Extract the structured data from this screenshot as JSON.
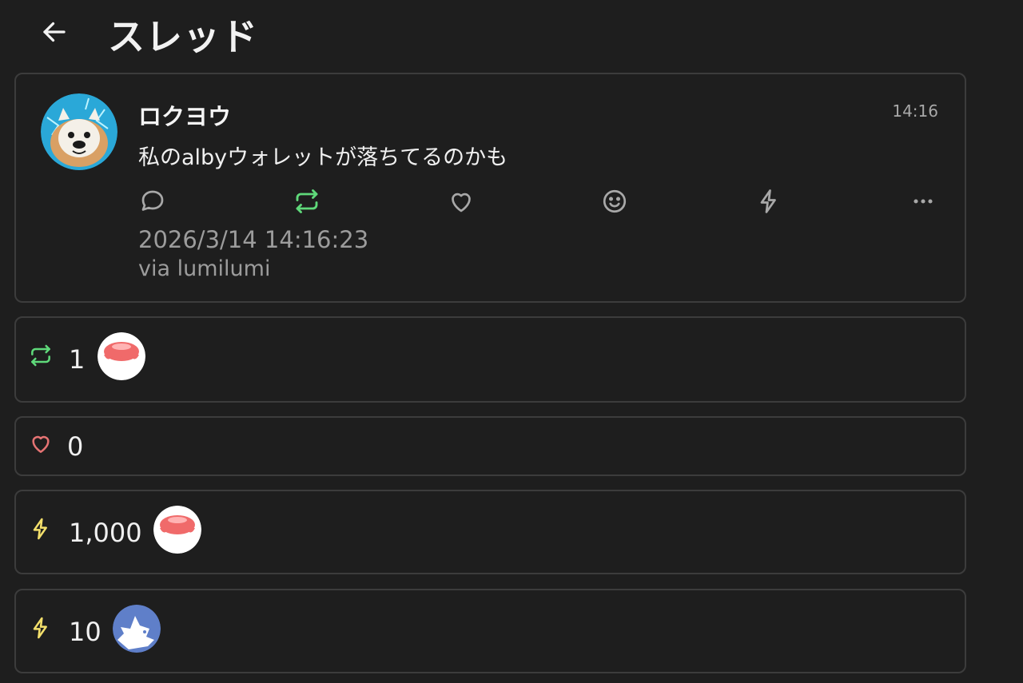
{
  "header": {
    "title": "スレッド",
    "back_icon": "arrow-left-icon"
  },
  "post": {
    "author": "ロクヨウ",
    "time": "14:16",
    "content": "私のalbyウォレットが落ちてるのかも",
    "datetime": "2026/3/14 14:16:23",
    "via": "via lumilumi",
    "actions": [
      "reply-icon",
      "repost-icon",
      "heart-icon",
      "emoji-reaction-icon",
      "zap-icon",
      "more-icon"
    ]
  },
  "colors": {
    "background": "#1e1e1e",
    "border": "#3c3c3c",
    "repost": "#5fd97a",
    "like": "#e57373",
    "zap": "#f3df6b",
    "icon": "#a8a8a8",
    "muted_text": "#9c9c9c"
  },
  "reactions": [
    {
      "type": "repost",
      "icon": "repost-icon",
      "count": "1",
      "avatars": [
        "red-jellyfish-avatar"
      ]
    },
    {
      "type": "like",
      "icon": "heart-icon",
      "count": "0",
      "avatars": []
    },
    {
      "type": "zap",
      "icon": "zap-icon",
      "count": "1,000",
      "avatars": [
        "red-jellyfish-avatar"
      ]
    },
    {
      "type": "zap",
      "icon": "zap-icon",
      "count": "10",
      "avatars": [
        "blue-bird-avatar"
      ]
    }
  ]
}
